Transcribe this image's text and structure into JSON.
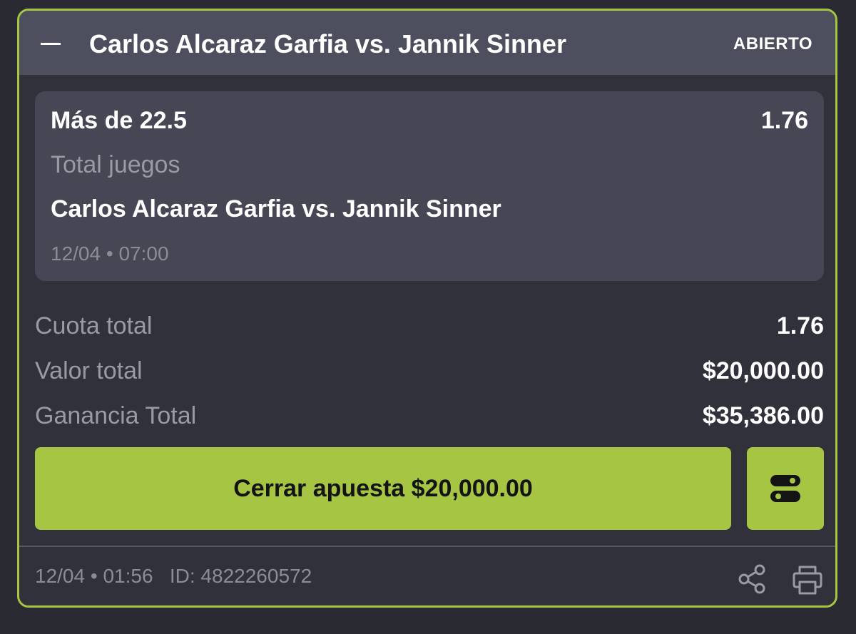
{
  "header": {
    "collapse_icon": "minus-icon",
    "title": "Carlos Alcaraz Garfia vs. Jannik Sinner",
    "status": "ABIERTO"
  },
  "selection": {
    "name": "Más de 22.5",
    "odds": "1.76",
    "market": "Total juegos",
    "event": "Carlos Alcaraz Garfia vs. Jannik Sinner",
    "date": "12/04",
    "time": "07:00"
  },
  "summary": {
    "odds_label": "Cuota total",
    "odds_value": "1.76",
    "stake_label": "Valor total",
    "stake_value": "$20,000.00",
    "payout_label": "Ganancia Total",
    "payout_value": "$35,386.00"
  },
  "actions": {
    "cashout_label": "Cerrar apuesta $20,000.00",
    "toggle_icon": "toggle-icon"
  },
  "footer": {
    "date": "12/04",
    "time": "01:56",
    "id_text": "ID: 4822260572",
    "share_icon": "share-icon",
    "print_icon": "print-icon"
  },
  "colors": {
    "accent": "#a6c543",
    "background": "#31313c",
    "header_bg": "#4e4f5e",
    "selection_bg": "#464654",
    "muted_text": "#9a9aa5"
  }
}
